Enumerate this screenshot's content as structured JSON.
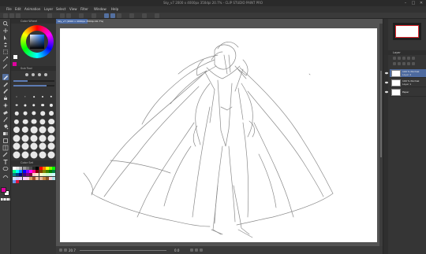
{
  "window": {
    "title": "Sky_v7 2000 x 4000px 350dpi 20.7% - CLIP STUDIO PAINT PRO",
    "minimize": "–",
    "maximize": "□",
    "close": "✕"
  },
  "menu": [
    "File",
    "Edit",
    "Animation",
    "Layer",
    "Select",
    "View",
    "Filter",
    "Window",
    "Help"
  ],
  "left_panel": {
    "color_wheel_tab": "Color Wheel",
    "sub_tool_tab": "Sub Tool",
    "palette_tab": "Color Set",
    "main_color": "#e000a0",
    "sub_color": "#ffffff",
    "brush_size_fill": 0.35,
    "opacity_fill": 0.8
  },
  "document": {
    "tab_label": "Sky_v7 (2000 x 4000px 350dpi 20.7%)"
  },
  "status": {
    "zoom": "20.7",
    "angle": "0.0"
  },
  "layers": {
    "header": "Layer",
    "items": [
      {
        "name": "100 % Normal",
        "sub": "Layer 2",
        "selected": true
      },
      {
        "name": "100 % Normal",
        "sub": "Layer 1",
        "selected": false
      },
      {
        "name": "Paper",
        "sub": "",
        "selected": false
      }
    ]
  },
  "palette_colors": [
    "#ffffff",
    "#e6e6e6",
    "#bfbfbf",
    "#999999",
    "#737373",
    "#4d4d4d",
    "#262626",
    "#000000",
    "#ff0000",
    "#ff8000",
    "#ffff00",
    "#80ff00",
    "#00ff00",
    "#00ff80",
    "#00ffff",
    "#0080ff",
    "#0000ff",
    "#8000ff",
    "#ff00ff",
    "#ff0080",
    "#800000",
    "#804000",
    "#808000",
    "#408000",
    "#008000",
    "#008040",
    "#008080",
    "#004080",
    "#000080",
    "#400080",
    "#800080",
    "#800040",
    "#ffcccc",
    "#ffe5cc",
    "#ffffcc",
    "#e5ffcc",
    "#ccffcc",
    "#ccffe5",
    "#ccffff",
    "#cce5ff",
    "#ccccff",
    "#e5ccff",
    "#ffccff",
    "#ffcce5",
    "#d9a066",
    "#a0522d",
    "#f4c2a1",
    "#e6b89c",
    "#c68642",
    "#8d5524",
    "#ffd1dc",
    "#b0e0e6",
    "#6495ed",
    "#dc143c"
  ]
}
